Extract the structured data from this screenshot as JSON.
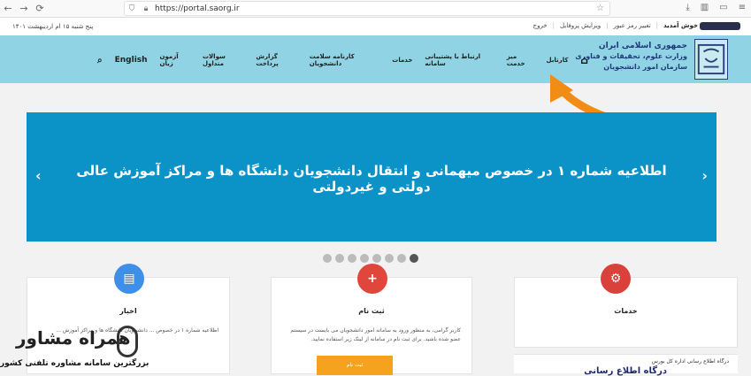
{
  "browser": {
    "url": "https://portal.saorg.ir",
    "back_icon": "arrow-left-icon",
    "forward_icon": "arrow-right-icon",
    "reload_icon": "reload-icon"
  },
  "topstrip": {
    "date": "پنج شنبه ۱۵ ام اردیبهشت ۱۴۰۱",
    "welcome": "خوش آمدید",
    "links": [
      "تغییر رمز عبور",
      "ویرایش پروفایل",
      "خروج"
    ]
  },
  "header": {
    "org_line1": "جمهوری اسلامی ایران",
    "org_line2": "وزارت علوم، تحقیقات و فناوری",
    "org_line3": "سازمان امور دانشجویان",
    "menu": [
      "کارتابل",
      "میز خدمت",
      "ارتباط با پشتیبانی سامانه",
      "خدمات",
      "کارنامه سلامت دانشجویان",
      "گزارش پرداخت",
      "سوالات متداول",
      "آزمون زبان"
    ],
    "english": "English",
    "accent_color": "#8fd3e4"
  },
  "slider": {
    "title": "اطلاعیه شماره ۱ در خصوص میهمانی و انتقال دانشجویان دانشگاه ها و مراکز آموزش عالی دولتی و غیردولتی",
    "prev_icon": "chevron-left-icon",
    "next_icon": "chevron-right-icon",
    "dots_total": 8,
    "active_dot": 8,
    "color": "#0b93c7"
  },
  "cards": {
    "news": {
      "title": "اخبار",
      "text": "اطلاعیه شماره ۱ در خصوص ... دانشجویان دانشگاه ها و مراکز آموزش ..."
    },
    "signup": {
      "title": "ثبت نام",
      "text": "کاربر گرامی، به منظور ورود به سامانه امور دانشجویان می بایست در سیستم عضو شده باشید. برای ثبت نام در سامانه از لینک زیر استفاده نمایید.",
      "button": "ثبت نام"
    },
    "services": {
      "title": "خدمات",
      "sub_text": "درگاه اطلاع رسانی اداره کل بورس",
      "sub_title": "درگاه اطلاع رسانی"
    }
  },
  "watermark": {
    "brand": "همراه مشاور",
    "sub": "بزرگترین سامانه مشاوره تلفنی کشور"
  }
}
